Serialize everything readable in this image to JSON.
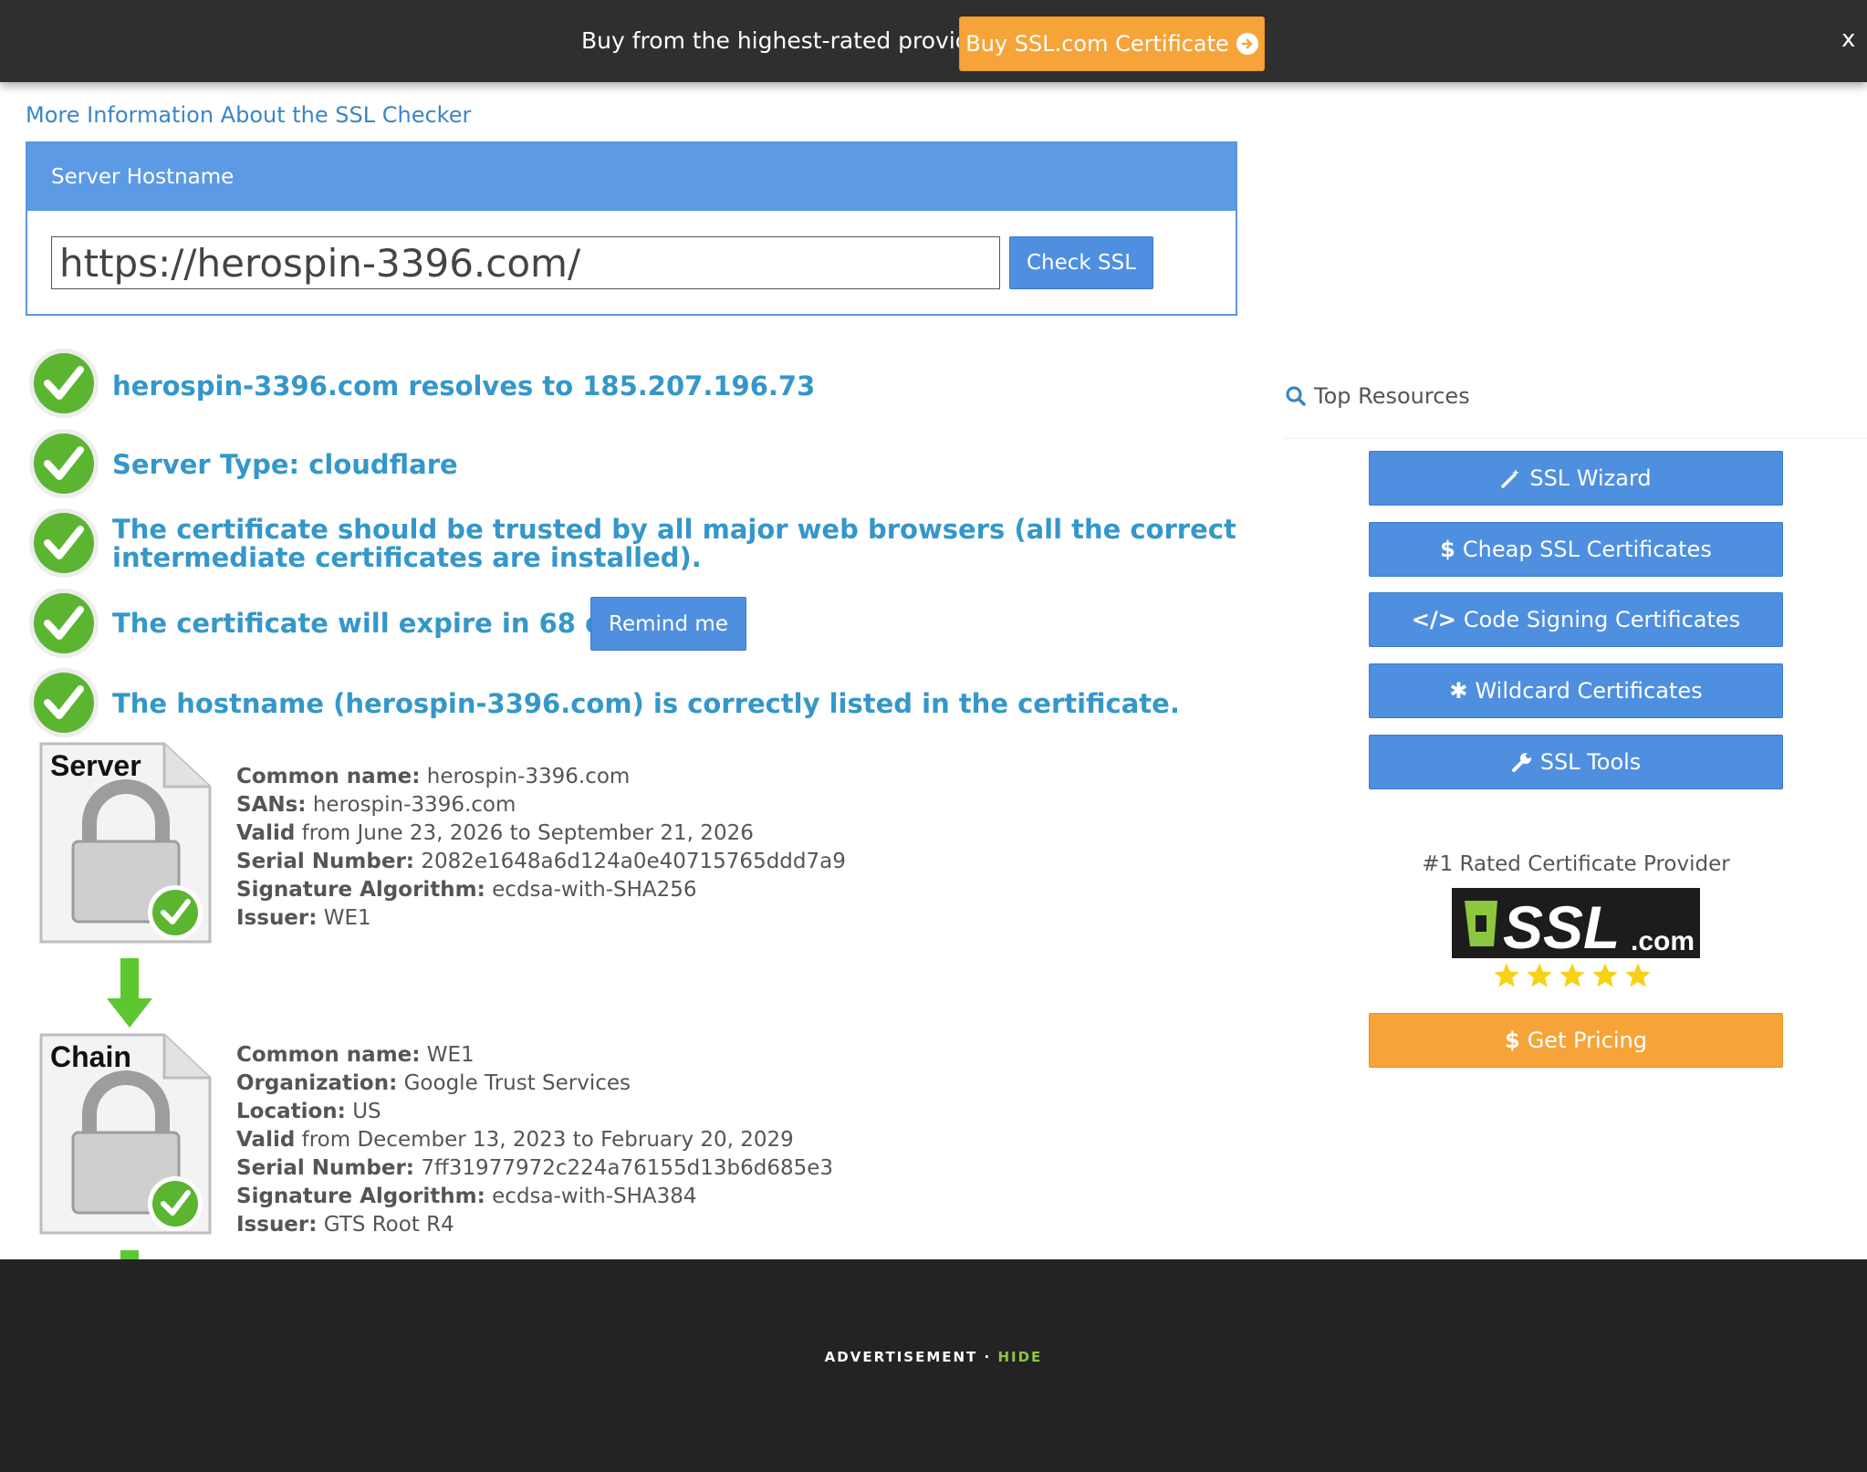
{
  "promo": {
    "text": "Buy from the highest-rated provider",
    "button_label": "Buy SSL.com Certificate",
    "close": "x"
  },
  "more_info_link": "More Information About the SSL Checker",
  "hostname_panel": {
    "title": "Server Hostname",
    "input_value": "https://herospin-3396.com/",
    "check_button": "Check SSL"
  },
  "results": [
    "herospin-3396.com resolves to 185.207.196.73",
    "Server Type: cloudflare",
    "The certificate should be trusted by all major web browsers (all the correct intermediate certificates are installed).",
    "The certificate will expire in 68 days.",
    "The hostname (herospin-3396.com) is correctly listed in the certificate."
  ],
  "remind_button": "Remind me",
  "server_cert": {
    "icon_label": "Server",
    "common_name_label": "Common name:",
    "common_name": "herospin-3396.com",
    "sans_label": "SANs:",
    "sans": "herospin-3396.com",
    "valid_label": "Valid",
    "valid": "from June 23, 2026 to September 21, 2026",
    "serial_label": "Serial Number:",
    "serial": "2082e1648a6d124a0e40715765ddd7a9",
    "sig_label": "Signature Algorithm:",
    "sig": "ecdsa-with-SHA256",
    "issuer_label": "Issuer:",
    "issuer": "WE1"
  },
  "chain_cert": {
    "icon_label": "Chain",
    "common_name_label": "Common name:",
    "common_name": "WE1",
    "org_label": "Organization:",
    "org": "Google Trust Services",
    "location_label": "Location:",
    "location": "US",
    "valid_label": "Valid",
    "valid": "from December 13, 2023 to February 20, 2029",
    "serial_label": "Serial Number:",
    "serial": "7ff31977972c224a76155d13b6d685e3",
    "sig_label": "Signature Algorithm:",
    "sig": "ecdsa-with-SHA384",
    "issuer_label": "Issuer:",
    "issuer": "GTS Root R4"
  },
  "sidebar": {
    "heading": "Top Resources",
    "buttons": [
      "SSL Wizard",
      "Cheap SSL Certificates",
      "Code Signing Certificates",
      "Wildcard Certificates",
      "SSL Tools"
    ],
    "rated_text": "#1 Rated Certificate Provider",
    "logo_text": "SSL",
    "logo_suffix": ".com",
    "rating_stars": 5,
    "pricing_button": "Get Pricing"
  },
  "ad": {
    "label": "ADVERTISEMENT",
    "separator": "·",
    "hide": "HIDE"
  },
  "colors": {
    "accent_blue": "#4f8fe0",
    "result_blue": "#3597c9",
    "orange": "#f6a43a",
    "check_green": "#5cb531",
    "logo_green": "#8dc63f"
  }
}
